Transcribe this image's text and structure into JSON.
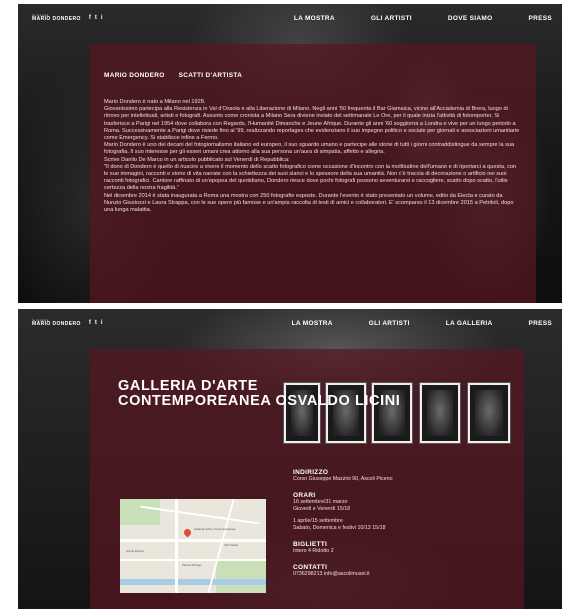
{
  "screen1": {
    "logo_small": "la mostra",
    "logo_main": "MARIO DONDERO",
    "social": [
      "f",
      "t",
      "i"
    ],
    "nav": [
      "LA MOSTRA",
      "GLI ARTISTI",
      "DOVE SIAMO",
      "PRESS"
    ],
    "tabs": [
      "MARIO DONDERO",
      "SCATTI D'ARTISTA"
    ],
    "bio": [
      "Mario Dondero è nato a Milano nel 1928.",
      "Giovanissimo partecipa alla Resistenza in Val d'Ossola e alla Liberazione di Milano. Negli anni '50 frequenta il Bar Giamaica, vicino all'Accademia di Brera, luogo di ritrovo per intellettuali, artisti e fotografi. Assunto come cronista a Milano Sera diviene inviato del settimanale Le Ore, per il quale inizia l'attività di fotoreporter. Si trasferisce a Parigi nel 1954 dove collabora con Regards, l'Humanité Dimanche e Jeune Afrique. Durante gli anni '60 soggiorna a Londra e vive per un lungo periodo a Roma. Successivamente a Parigi dove risiede fino al '99, realizzando reportages che evidenziano il suo impegno politico e sociale per giornali e associazioni umanitarie come Emergency. Si stabilisce infine a Fermo.",
      "Mario Dondero è uno dei decani del fotogiornalismo italiano ed europeo, il suo sguardo umano e partecipe alle storie di tutti i giorni contraddistingue da sempre la sua fotografia. Il suo interesse per gli esseri umani crea attorno alla sua persona un'aura di simpatia, affetto e allegria.",
      "Scrive Danilo De Marco in un articolo pubblicato sul Venerdì di Repubblica:",
      "\"Il dono di Dondero è quello di riuscire a vivere il momento dello scatto fotografico come occasione d'incontro con la moltitudine dell'umano e di riportarci a questa, con le sue immagini, racconti e storie di vita narrate con la schiettezza dei suoi slanci e lo spessore della sua umanità. Non c'è traccia di decorazione o artificio nei suoi racconti fotografici. Cantore raffinato di un'epopea del quotidiano, Dondero riesce dove pochi fotografi possono avventurarsi e raccogliere, scatto dopo scatto, l'utile certezza della nostra fragilità.\"",
      "Nel dicembre 2014 è stata inaugurata a Roma una mostra con 250 fotografie esposte. Durante l'evento è stato presentato un volume, edito da Electa e curato da Nunzio Giustozzi e Laura Strappa, con le sue opere più famose e un'ampia raccolta di testi di amici e collaboratori. E' scomparso il 13 dicembre 2015 a Petritoli, dopo una lunga malattia."
    ]
  },
  "screen2": {
    "logo_small": "la mostra",
    "logo_main": "MARIO DONDERO",
    "social": [
      "f",
      "t",
      "i"
    ],
    "nav": [
      "LA MOSTRA",
      "GLI ARTISTI",
      "LA GALLERIA",
      "PRESS"
    ],
    "title_line1": "GALLERIA D'ARTE",
    "title_line2": "CONTEMPOREANEA OSVALDO LICINI",
    "map_pin_label": "Galleria d'Arte Contemporanea",
    "map_labels": [
      "Ascoli Piceno",
      "Piazza Arringo",
      "Via Trieste"
    ],
    "indirizzo_h": "INDIRIZZO",
    "indirizzo": "Corso Giuseppe Mazzini 90, Ascoli Piceno",
    "orari_h": "ORARI",
    "orari_1a": "16 settembre/31 marzo",
    "orari_1b": "Giovedì e Venerdì 15/18",
    "orari_2a": "1 aprile/15 settembre",
    "orari_2b": "Sabato, Domenica e festivi 10/13 15/18",
    "biglietti_h": "BIGLIETTI",
    "biglietti": "Intero 4 Ridotto 2",
    "contatti_h": "CONTATTI",
    "contatti": "0736298213 info@ascolimusei.it"
  }
}
